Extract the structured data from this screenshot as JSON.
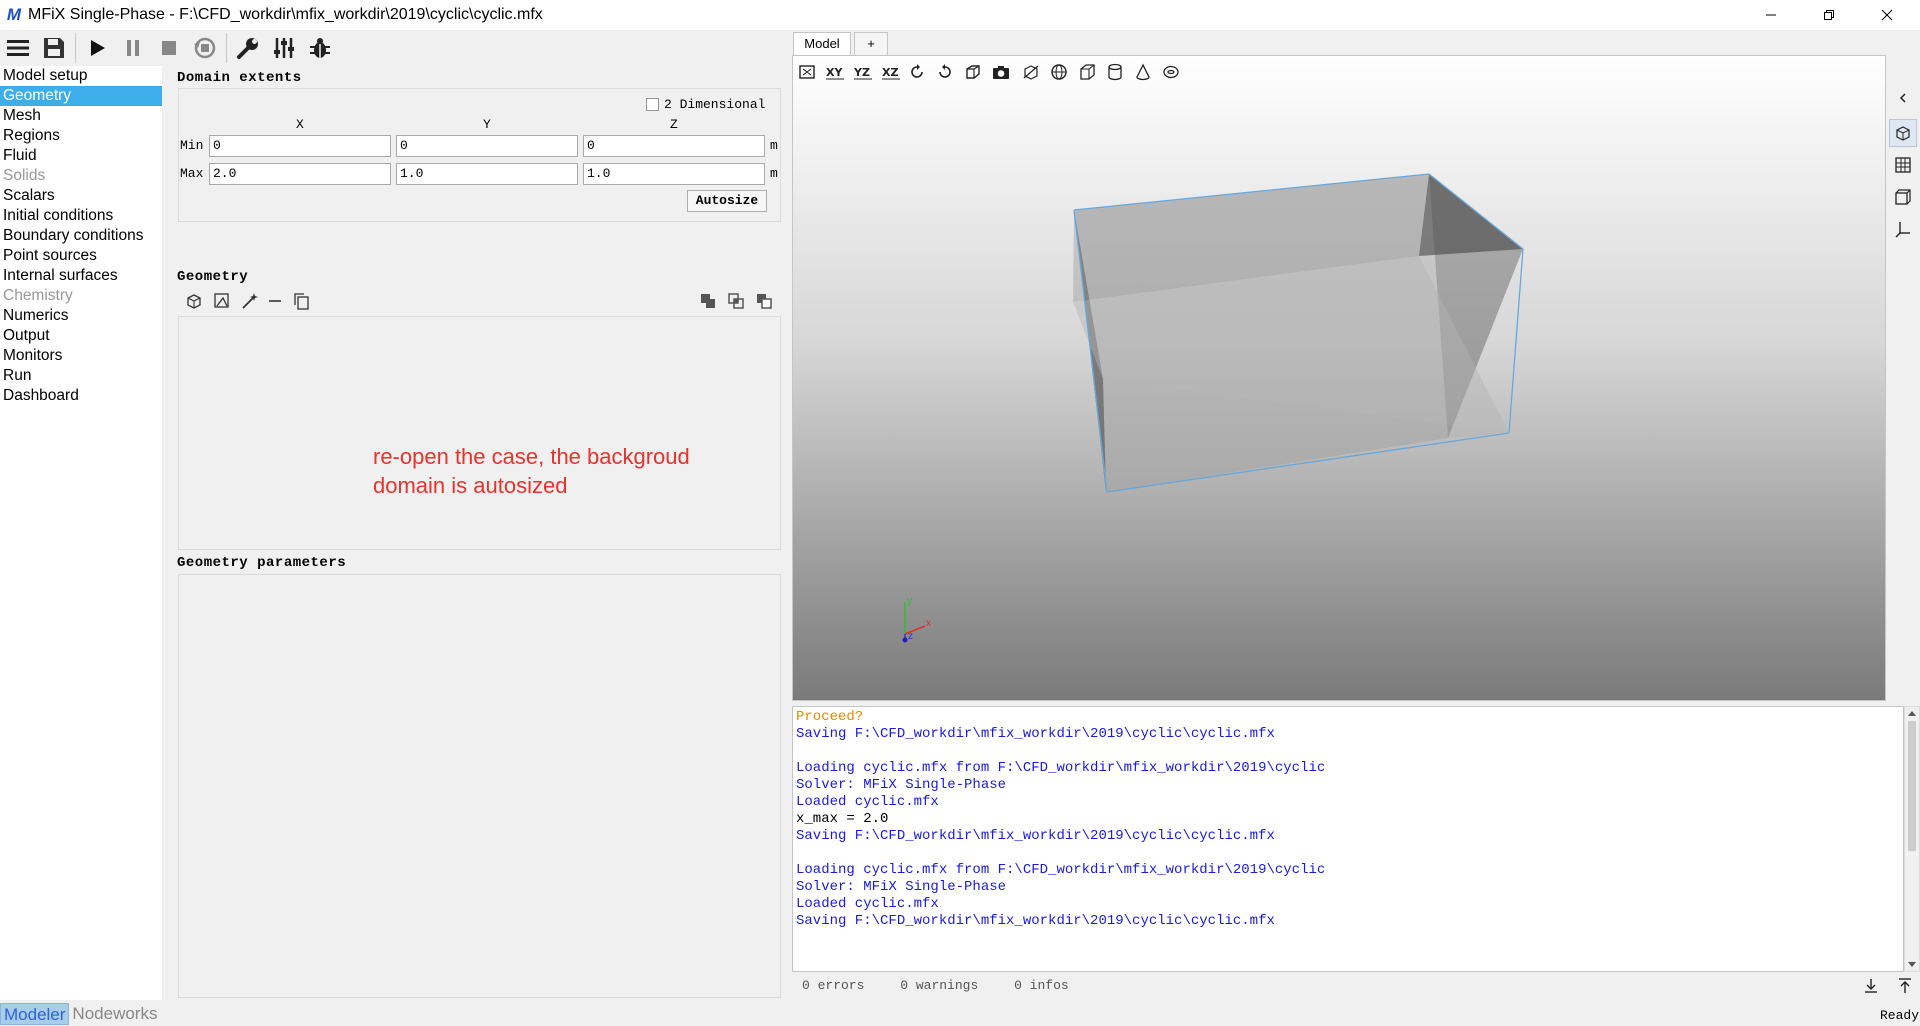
{
  "window": {
    "title": "MFiX Single-Phase - F:\\CFD_workdir\\mfix_workdir\\2019\\cyclic\\cyclic.mfx",
    "logo_text": "M"
  },
  "toolbar": {
    "icons": [
      "menu-icon",
      "save-icon",
      "play-icon",
      "pause-icon",
      "stop-icon",
      "reset-icon",
      "wrench-icon",
      "sliders-icon",
      "bug-icon"
    ]
  },
  "nav": {
    "items": [
      {
        "label": "Model setup",
        "state": "normal"
      },
      {
        "label": "Geometry",
        "state": "selected"
      },
      {
        "label": "Mesh",
        "state": "normal"
      },
      {
        "label": "Regions",
        "state": "normal"
      },
      {
        "label": "Fluid",
        "state": "normal"
      },
      {
        "label": "Solids",
        "state": "disabled"
      },
      {
        "label": "Scalars",
        "state": "normal"
      },
      {
        "label": "Initial conditions",
        "state": "normal"
      },
      {
        "label": "Boundary conditions",
        "state": "normal"
      },
      {
        "label": "Point sources",
        "state": "normal"
      },
      {
        "label": "Internal surfaces",
        "state": "normal"
      },
      {
        "label": "Chemistry",
        "state": "disabled"
      },
      {
        "label": "Numerics",
        "state": "normal"
      },
      {
        "label": "Output",
        "state": "normal"
      },
      {
        "label": "Monitors",
        "state": "normal"
      },
      {
        "label": "Run",
        "state": "normal"
      },
      {
        "label": "Dashboard",
        "state": "normal"
      }
    ]
  },
  "domain": {
    "title": "Domain extents",
    "two_dimensional_label": "2 Dimensional",
    "two_dimensional_checked": false,
    "col_x": "X",
    "col_y": "Y",
    "col_z": "Z",
    "min_label": "Min",
    "max_label": "Max",
    "unit": "m",
    "min": {
      "x": "0",
      "y": "0",
      "z": "0"
    },
    "max": {
      "x": "2.0",
      "y": "1.0",
      "z": "1.0"
    },
    "autosize_label": "Autosize"
  },
  "geometry": {
    "title": "Geometry",
    "params_title": "Geometry parameters"
  },
  "annotation": {
    "line1": "re-open the case, the backgroud",
    "line2": "domain is autosized"
  },
  "tabs": {
    "model": "Model",
    "add": "+"
  },
  "axes": {
    "x": "x",
    "y": "y",
    "z": "z"
  },
  "console": {
    "lines": [
      {
        "text": "Proceed?",
        "color": "#e08a00"
      },
      {
        "text": "Saving F:\\CFD_workdir\\mfix_workdir\\2019\\cyclic\\cyclic.mfx",
        "color": "#1a1ae6"
      },
      {
        "text": "",
        "color": "#000"
      },
      {
        "text": "Loading cyclic.mfx from F:\\CFD_workdir\\mfix_workdir\\2019\\cyclic",
        "color": "#1a1ae6"
      },
      {
        "text": "Solver: MFiX Single-Phase",
        "color": "#1a1ae6"
      },
      {
        "text": "Loaded cyclic.mfx",
        "color": "#1a1ae6"
      },
      {
        "text": "x_max = 2.0",
        "color": "#000000"
      },
      {
        "text": "Saving F:\\CFD_workdir\\mfix_workdir\\2019\\cyclic\\cyclic.mfx",
        "color": "#1a1ae6"
      },
      {
        "text": "",
        "color": "#000"
      },
      {
        "text": "Loading cyclic.mfx from F:\\CFD_workdir\\mfix_workdir\\2019\\cyclic",
        "color": "#1a1ae6"
      },
      {
        "text": "Solver: MFiX Single-Phase",
        "color": "#1a1ae6"
      },
      {
        "text": "Loaded cyclic.mfx",
        "color": "#1a1ae6"
      },
      {
        "text": "Saving F:\\CFD_workdir\\mfix_workdir\\2019\\cyclic\\cyclic.mfx",
        "color": "#1a1ae6"
      }
    ]
  },
  "status": {
    "errors": "0 errors",
    "warnings": "0 warnings",
    "infos": "0 infos",
    "ready": "Ready"
  },
  "bottom_tabs": {
    "modeler": "Modeler",
    "nodeworks": "Nodeworks"
  },
  "colors": {
    "selection": "#3daee9",
    "annotation": "#e8322c",
    "log_blue": "#1a1ae6",
    "log_orange": "#e08a00"
  }
}
